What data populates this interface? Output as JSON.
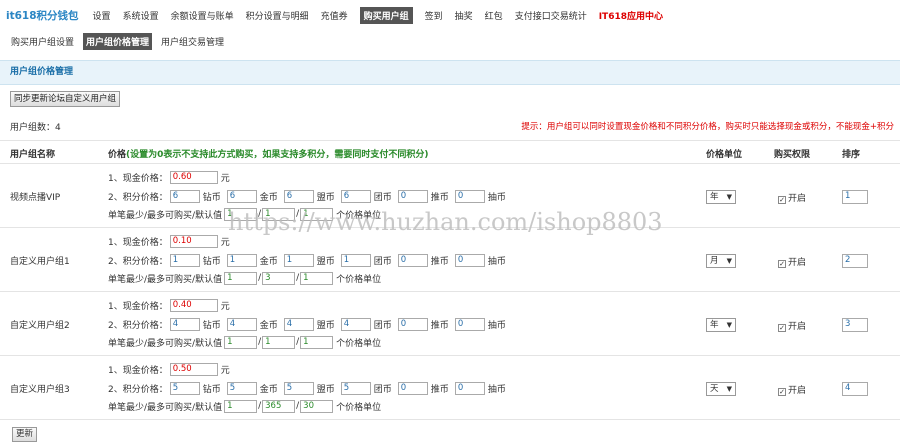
{
  "app": {
    "brand": "it618积分钱包"
  },
  "topnav": {
    "items": [
      "设置",
      "系统设置",
      "余额设置与账单",
      "积分设置与明细",
      "充值券",
      "购买用户组",
      "签到",
      "抽奖",
      "红包",
      "支付接口交易统计",
      "IT618应用中心"
    ]
  },
  "subnav": {
    "items": [
      "购买用户组设置",
      "用户组价格管理",
      "用户组交易管理"
    ]
  },
  "section": {
    "title": "用户组价格管理"
  },
  "toolbar": {
    "sync_label": "同步更新论坛自定义用户组",
    "update_label": "更新"
  },
  "summary": {
    "count_text": "用户组数：4"
  },
  "hint": {
    "text": "提示：用户组可以同时设置现金价格和不同积分价格，购买时只能选择现金或积分，不能现金+积分"
  },
  "table": {
    "headers": {
      "name": "用户组名称",
      "price": "价格",
      "price_note": "(设置为0表示不支持此方式购买，如果支持多积分，需要同时支付不同积分)",
      "unit": "价格单位",
      "perm": "购买权限",
      "order": "排序"
    },
    "labels": {
      "cash": "1、现金价格：",
      "cash_unit": "元",
      "points": "2、积分价格：",
      "limits": "单笔最少/最多可购买/默认值",
      "limit_unit": "个价格单位",
      "perm_label": "开启",
      "currencies": [
        "钻币",
        "金币",
        "盟币",
        "团币",
        "推币",
        "抽币"
      ]
    },
    "rows": [
      {
        "name": "视频点播VIP",
        "cash": "0.60",
        "points": [
          "6",
          "6",
          "6",
          "6",
          "0",
          "0"
        ],
        "min": "1",
        "max": "1",
        "default": "1",
        "unit": "年",
        "order": "1"
      },
      {
        "name": "自定义用户组1",
        "cash": "0.10",
        "points": [
          "1",
          "1",
          "1",
          "1",
          "0",
          "0"
        ],
        "min": "1",
        "max": "3",
        "default": "1",
        "unit": "月",
        "order": "2"
      },
      {
        "name": "自定义用户组2",
        "cash": "0.40",
        "points": [
          "4",
          "4",
          "4",
          "4",
          "0",
          "0"
        ],
        "min": "1",
        "max": "1",
        "default": "1",
        "unit": "年",
        "order": "3"
      },
      {
        "name": "自定义用户组3",
        "cash": "0.50",
        "points": [
          "5",
          "5",
          "5",
          "5",
          "0",
          "0"
        ],
        "min": "1",
        "max": "365",
        "default": "30",
        "unit": "天",
        "order": "4"
      }
    ]
  },
  "watermark": {
    "text": "https://www.huzhan.com/ishop8803"
  }
}
